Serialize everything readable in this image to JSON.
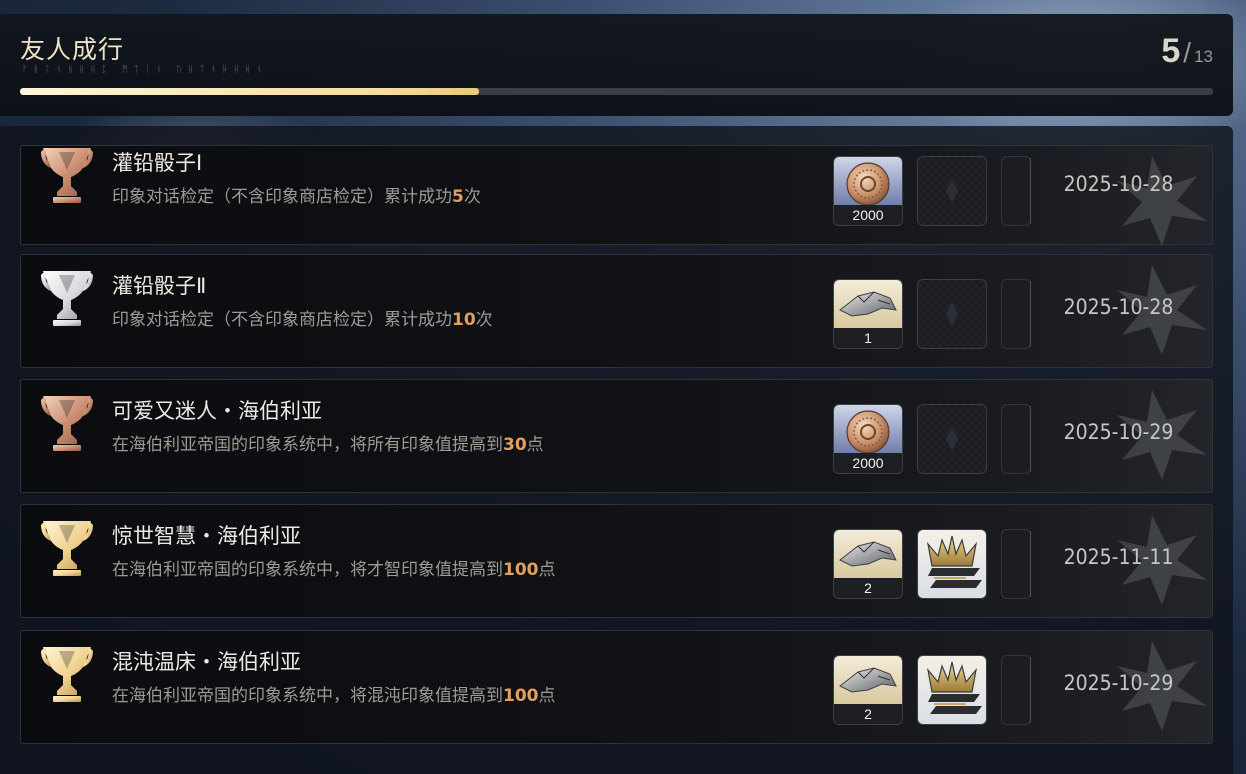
{
  "header": {
    "title": "友人成行",
    "subtitle": "ᚨᛒᛚᚾᚺᚺᚺᛈ ᛗᛏᛁᚾ ᚢᚺᛏᚾᚺᚺᚺᚾ",
    "progress_current": "5",
    "progress_total": "13",
    "progress_fraction": 0.385
  },
  "achievements": [
    {
      "name": "灌铅骰子Ⅰ",
      "desc_prefix": "印象对话检定（不含印象商店检定）累计成功",
      "desc_num": "5",
      "desc_suffix": "次",
      "trophy": "bronze",
      "rewards": [
        {
          "icon": "coin-icon",
          "qty": "2000"
        }
      ],
      "crown": false,
      "date": "2025-10-28"
    },
    {
      "name": "灌铅骰子Ⅱ",
      "desc_prefix": "印象对话检定（不含印象商店检定）累计成功",
      "desc_num": "10",
      "desc_suffix": "次",
      "trophy": "silver",
      "rewards": [
        {
          "icon": "blade-material-icon",
          "qty": "1"
        }
      ],
      "crown": false,
      "date": "2025-10-28"
    },
    {
      "name": "可爱又迷人・海伯利亚",
      "desc_prefix": "在海伯利亚帝国的印象系统中，将所有印象值提高到",
      "desc_num": "30",
      "desc_suffix": "点",
      "trophy": "bronze",
      "rewards": [
        {
          "icon": "coin-icon",
          "qty": "2000"
        }
      ],
      "crown": false,
      "date": "2025-10-29"
    },
    {
      "name": "惊世智慧・海伯利亚",
      "desc_prefix": "在海伯利亚帝国的印象系统中，将才智印象值提高到",
      "desc_num": "100",
      "desc_suffix": "点",
      "trophy": "gold",
      "rewards": [
        {
          "icon": "blade-material-icon",
          "qty": "2"
        }
      ],
      "crown": true,
      "date": "2025-11-11"
    },
    {
      "name": "混沌温床・海伯利亚",
      "desc_prefix": "在海伯利亚帝国的印象系统中，将混沌印象值提高到",
      "desc_num": "100",
      "desc_suffix": "点",
      "trophy": "gold",
      "rewards": [
        {
          "icon": "blade-material-icon",
          "qty": "2"
        }
      ],
      "crown": true,
      "date": "2025-10-29"
    }
  ],
  "colors": {
    "bronze": "#d9a78c",
    "silver": "#e8e8ea",
    "gold": "#f3d898",
    "highlight_number": "#e2a060"
  }
}
